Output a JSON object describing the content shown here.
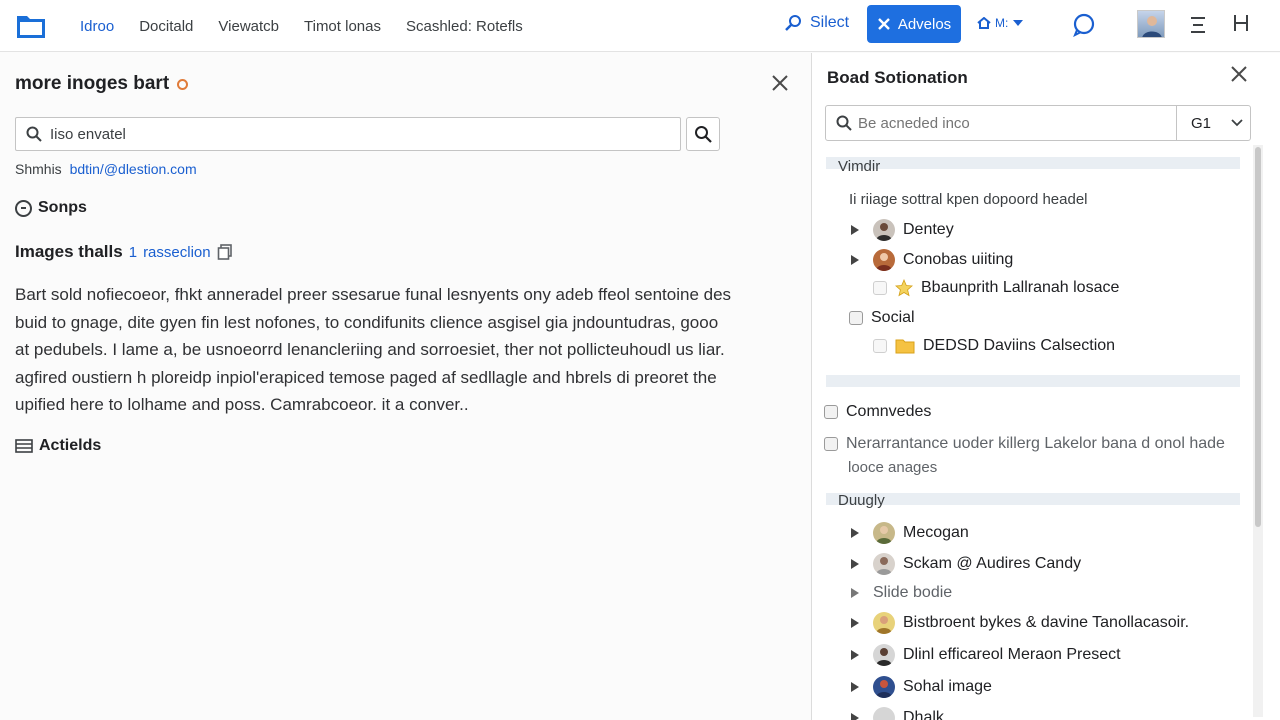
{
  "nav": {
    "links": [
      "Idroo",
      "Docitald",
      "Viewatcb",
      "Timot lonas",
      "Scashled: Rotefls"
    ],
    "select_label": "Silect",
    "advanced_label": "Advelos",
    "mm_label": "M:"
  },
  "left": {
    "title": "more inoges bart",
    "search_value": "Iiso envatel",
    "meta_label": "Shmhis",
    "meta_email": "bdtin/@dlestion.com",
    "sonps_label": "Sonps",
    "images_label": "Images thalls",
    "images_count": "1",
    "images_link": "rasseclion",
    "paragraph": [
      "Bart sold nofiecoeor, fhkt anneradel preer ssesarue funal lesnyents ony adeb ffeol sentoine des",
      "buid to gnage, dite gyen fin lest nofones, to condifunits clience asgisel gia jndountudras, gooo",
      "at pedubels.  I lame a, be usnoeorrd lenancleriing and sorroesiet, ther not pollicteuhoudl us liar.",
      "agfired oustiern h ploreidp inpiol'erapiced temose paged af sedllagle and hbrels di preoret the",
      "upified here to lolhame and poss. Camrabcoeor. it a conver.."
    ],
    "actlds_label": "Actields"
  },
  "right": {
    "title": "Boad Sotionation",
    "search_placeholder": "Be acneded inco",
    "select_value": "G1",
    "section1": "Vimdir",
    "subhead1": "Ii riiage sottral kpen dopoord headel",
    "items1": [
      "Dentey",
      "Conobas uiiting",
      "Bbaunprith Lallranah losace",
      "Social",
      "DEDSD Daviins Calsection"
    ],
    "check_items": [
      "Comnvedes",
      "Nerarrantance uoder killerg Lakelor bana d onol hade",
      "looce anages"
    ],
    "section2": "Duugly",
    "items2": [
      "Mecogan",
      "Sckam @ Audires Candy",
      "Slide bodie",
      "Bistbroent bykes & davine Tanollacasoir.",
      "Dlinl efficareol Meraon Presect",
      "Sohal image",
      "Dhalk"
    ]
  },
  "colors": {
    "accent": "#1e6fe0",
    "link": "#1a5fd0",
    "title_dot": "#e07b39"
  }
}
